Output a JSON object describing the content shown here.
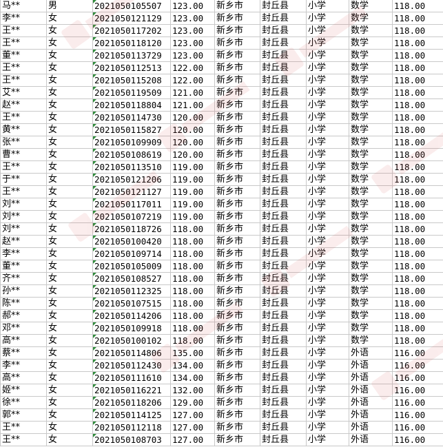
{
  "rows": [
    {
      "name": "马**",
      "gender": "男",
      "id": "2021050105507",
      "score": "123.00",
      "city": "新乡市",
      "county": "封丘县",
      "level": "小学",
      "subject": "数学",
      "line": "118.00"
    },
    {
      "name": "李**",
      "gender": "女",
      "id": "2021050121129",
      "score": "123.00",
      "city": "新乡市",
      "county": "封丘县",
      "level": "小学",
      "subject": "数学",
      "line": "118.00"
    },
    {
      "name": "王**",
      "gender": "女",
      "id": "2021050117202",
      "score": "123.00",
      "city": "新乡市",
      "county": "封丘县",
      "level": "小学",
      "subject": "数学",
      "line": "118.00"
    },
    {
      "name": "王**",
      "gender": "女",
      "id": "2021050118120",
      "score": "123.00",
      "city": "新乡市",
      "county": "封丘县",
      "level": "小学",
      "subject": "数学",
      "line": "118.00"
    },
    {
      "name": "董**",
      "gender": "女",
      "id": "2021050113729",
      "score": "123.00",
      "city": "新乡市",
      "county": "封丘县",
      "level": "小学",
      "subject": "数学",
      "line": "118.00"
    },
    {
      "name": "王**",
      "gender": "女",
      "id": "2021050112513",
      "score": "122.00",
      "city": "新乡市",
      "county": "封丘县",
      "level": "小学",
      "subject": "数学",
      "line": "118.00"
    },
    {
      "name": "王**",
      "gender": "女",
      "id": "2021050115208",
      "score": "122.00",
      "city": "新乡市",
      "county": "封丘县",
      "level": "小学",
      "subject": "数学",
      "line": "118.00"
    },
    {
      "name": "艾**",
      "gender": "女",
      "id": "2021050119509",
      "score": "121.00",
      "city": "新乡市",
      "county": "封丘县",
      "level": "小学",
      "subject": "数学",
      "line": "118.00"
    },
    {
      "name": "赵**",
      "gender": "女",
      "id": "2021050118804",
      "score": "121.00",
      "city": "新乡市",
      "county": "封丘县",
      "level": "小学",
      "subject": "数学",
      "line": "118.00"
    },
    {
      "name": "王**",
      "gender": "女",
      "id": "2021050114730",
      "score": "120.00",
      "city": "新乡市",
      "county": "封丘县",
      "level": "小学",
      "subject": "数学",
      "line": "118.00"
    },
    {
      "name": "黄**",
      "gender": "女",
      "id": "2021050115827",
      "score": "120.00",
      "city": "新乡市",
      "county": "封丘县",
      "level": "小学",
      "subject": "数学",
      "line": "118.00"
    },
    {
      "name": "张**",
      "gender": "女",
      "id": "2021050109909",
      "score": "120.00",
      "city": "新乡市",
      "county": "封丘县",
      "level": "小学",
      "subject": "数学",
      "line": "118.00"
    },
    {
      "name": "曹**",
      "gender": "女",
      "id": "2021050108619",
      "score": "120.00",
      "city": "新乡市",
      "county": "封丘县",
      "level": "小学",
      "subject": "数学",
      "line": "118.00"
    },
    {
      "name": "王**",
      "gender": "女",
      "id": "2021050113510",
      "score": "119.00",
      "city": "新乡市",
      "county": "封丘县",
      "level": "小学",
      "subject": "数学",
      "line": "118.00"
    },
    {
      "name": "于**",
      "gender": "女",
      "id": "2021050121206",
      "score": "119.00",
      "city": "新乡市",
      "county": "封丘县",
      "level": "小学",
      "subject": "数学",
      "line": "118.00"
    },
    {
      "name": "王**",
      "gender": "女",
      "id": "2021050121127",
      "score": "119.00",
      "city": "新乡市",
      "county": "封丘县",
      "level": "小学",
      "subject": "数学",
      "line": "118.00"
    },
    {
      "name": "刘**",
      "gender": "女",
      "id": "2021050117011",
      "score": "119.00",
      "city": "新乡市",
      "county": "封丘县",
      "level": "小学",
      "subject": "数学",
      "line": "118.00"
    },
    {
      "name": "刘**",
      "gender": "女",
      "id": "2021050107219",
      "score": "119.00",
      "city": "新乡市",
      "county": "封丘县",
      "level": "小学",
      "subject": "数学",
      "line": "118.00"
    },
    {
      "name": "刘**",
      "gender": "女",
      "id": "2021050118726",
      "score": "118.00",
      "city": "新乡市",
      "county": "封丘县",
      "level": "小学",
      "subject": "数学",
      "line": "118.00"
    },
    {
      "name": "赵**",
      "gender": "女",
      "id": "2021050100420",
      "score": "118.00",
      "city": "新乡市",
      "county": "封丘县",
      "level": "小学",
      "subject": "数学",
      "line": "118.00"
    },
    {
      "name": "李**",
      "gender": "女",
      "id": "2021050109714",
      "score": "118.00",
      "city": "新乡市",
      "county": "封丘县",
      "level": "小学",
      "subject": "数学",
      "line": "118.00"
    },
    {
      "name": "董**",
      "gender": "女",
      "id": "2021050105009",
      "score": "118.00",
      "city": "新乡市",
      "county": "封丘县",
      "level": "小学",
      "subject": "数学",
      "line": "118.00"
    },
    {
      "name": "齐**",
      "gender": "女",
      "id": "2021050108527",
      "score": "118.00",
      "city": "新乡市",
      "county": "封丘县",
      "level": "小学",
      "subject": "数学",
      "line": "118.00"
    },
    {
      "name": "孙**",
      "gender": "女",
      "id": "2021050112325",
      "score": "118.00",
      "city": "新乡市",
      "county": "封丘县",
      "level": "小学",
      "subject": "数学",
      "line": "118.00"
    },
    {
      "name": "陈**",
      "gender": "女",
      "id": "2021050107515",
      "score": "118.00",
      "city": "新乡市",
      "county": "封丘县",
      "level": "小学",
      "subject": "数学",
      "line": "118.00"
    },
    {
      "name": "郝**",
      "gender": "女",
      "id": "2021050114206",
      "score": "118.00",
      "city": "新乡市",
      "county": "封丘县",
      "level": "小学",
      "subject": "数学",
      "line": "118.00"
    },
    {
      "name": "邓**",
      "gender": "女",
      "id": "2021050109918",
      "score": "118.00",
      "city": "新乡市",
      "county": "封丘县",
      "level": "小学",
      "subject": "数学",
      "line": "118.00"
    },
    {
      "name": "高**",
      "gender": "女",
      "id": "2021050100102",
      "score": "118.00",
      "city": "新乡市",
      "county": "封丘县",
      "level": "小学",
      "subject": "数学",
      "line": "118.00"
    },
    {
      "name": "蔡**",
      "gender": "女",
      "id": "2021050114806",
      "score": "135.00",
      "city": "新乡市",
      "county": "封丘县",
      "level": "小学",
      "subject": "外语",
      "line": "116.00"
    },
    {
      "name": "李**",
      "gender": "女",
      "id": "2021050112430",
      "score": "134.00",
      "city": "新乡市",
      "county": "封丘县",
      "level": "小学",
      "subject": "外语",
      "line": "116.00"
    },
    {
      "name": "高**",
      "gender": "女",
      "id": "2021050111610",
      "score": "134.00",
      "city": "新乡市",
      "county": "封丘县",
      "level": "小学",
      "subject": "外语",
      "line": "116.00"
    },
    {
      "name": "姬**",
      "gender": "女",
      "id": "2021050116221",
      "score": "132.00",
      "city": "新乡市",
      "county": "封丘县",
      "level": "小学",
      "subject": "外语",
      "line": "116.00"
    },
    {
      "name": "徐**",
      "gender": "女",
      "id": "2021050118206",
      "score": "129.00",
      "city": "新乡市",
      "county": "封丘县",
      "level": "小学",
      "subject": "外语",
      "line": "116.00"
    },
    {
      "name": "郭**",
      "gender": "女",
      "id": "2021050114125",
      "score": "127.00",
      "city": "新乡市",
      "county": "封丘县",
      "level": "小学",
      "subject": "外语",
      "line": "116.00"
    },
    {
      "name": "王**",
      "gender": "女",
      "id": "2021050112118",
      "score": "127.00",
      "city": "新乡市",
      "county": "封丘县",
      "level": "小学",
      "subject": "外语",
      "line": "116.00"
    },
    {
      "name": "王**",
      "gender": "女",
      "id": "2021050108703",
      "score": "127.00",
      "city": "新乡市",
      "county": "封丘县",
      "level": "小学",
      "subject": "外语",
      "line": "116.00"
    }
  ],
  "colors": {
    "gridline": "#c8c8c8",
    "error_marker": "#2e8b3a",
    "watermark": "#d9534f"
  }
}
